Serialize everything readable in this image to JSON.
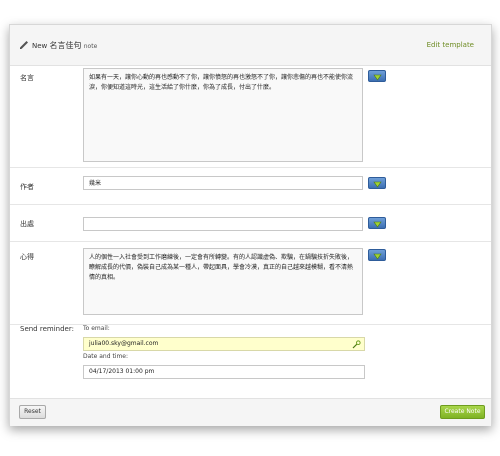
{
  "header": {
    "title_prefix": "New",
    "title_name": "名言佳句",
    "title_suffix": "note",
    "edit_link": "Edit template"
  },
  "fields": [
    {
      "label": "名言",
      "value": "如果有一天，讓你心動的再也感動不了你，讓你憤怒的再也激怒不了你，讓你悲傷的再也不能使你流淚，你便知道這時光，這生活給了你什麼，你為了成長，付出了什麼。"
    },
    {
      "label": "作者",
      "value": "幾米"
    },
    {
      "label": "出處",
      "value": ""
    },
    {
      "label": "心得",
      "value": "人的個性一入社會受到工作磨練後，一定會有所轉變。有的人認識虛偽、欺騙，在鍋騙技折失敗後，瞭解成長的代價，偽裝自己成為某一種人，帶起面具，學會冷漠，真正的自己越來越模糊，看不清熱情的真相。"
    }
  ],
  "reminder": {
    "label": "Send reminder:",
    "to_label": "To email:",
    "email": "julia00.sky@gmail.com",
    "date_label": "Date and time:",
    "datetime": "04/17/2013 01:00 pm"
  },
  "footer": {
    "reset": "Reset",
    "create": "Create Note"
  },
  "colors": {
    "accent_green": "#7fb324",
    "add_button_blue": "#3d6fb2",
    "email_highlight": "#ffffcc"
  }
}
